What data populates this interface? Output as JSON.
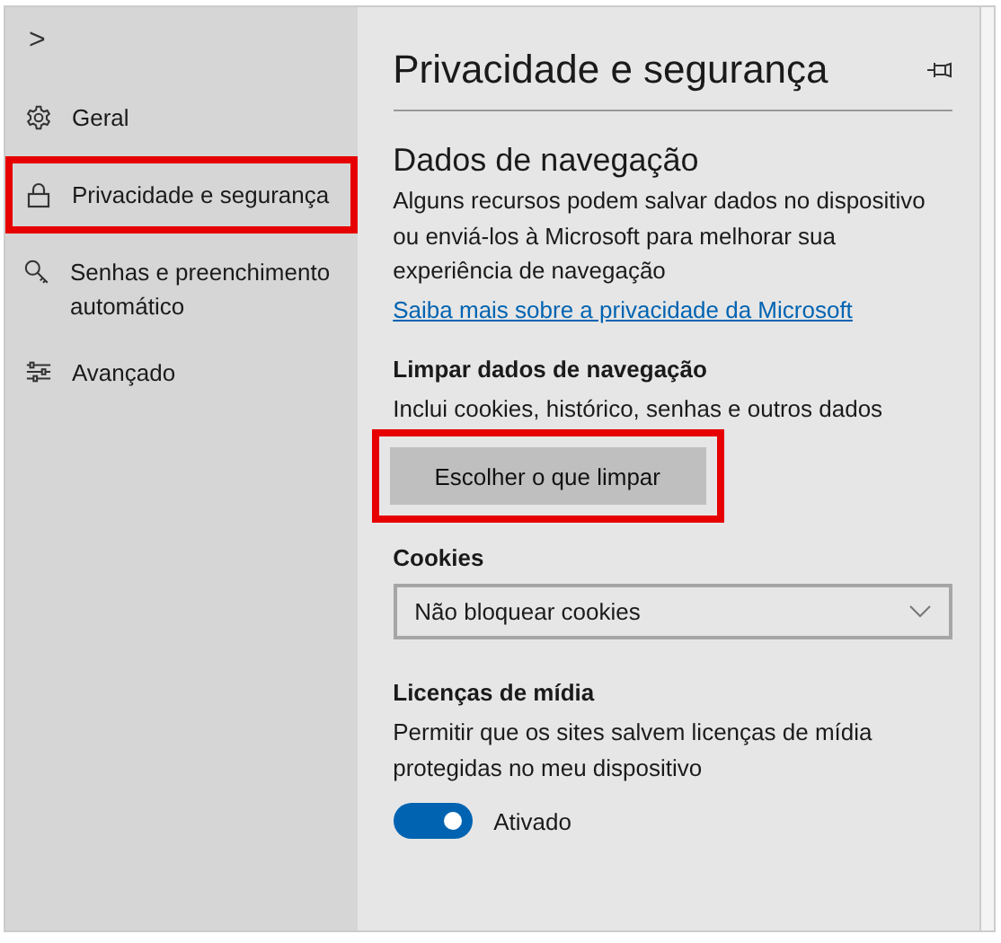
{
  "sidebar": {
    "collapse_glyph": ">",
    "items": [
      {
        "label": "Geral",
        "highlighted": false
      },
      {
        "label": "Privacidade e segurança",
        "highlighted": true
      },
      {
        "label": "Senhas e preenchimento automático",
        "highlighted": false
      },
      {
        "label": "Avançado",
        "highlighted": false
      }
    ]
  },
  "panel": {
    "title": "Privacidade e segurança",
    "browsing_data": {
      "heading": "Dados de navegação",
      "description": "Alguns recursos podem salvar dados no dispositivo ou enviá-los à Microsoft para melhorar sua experiência de navegação",
      "link": "Saiba mais sobre a privacidade da Microsoft"
    },
    "clear": {
      "heading": "Limpar dados de navegação",
      "description": "Inclui cookies, histórico, senhas e outros dados",
      "button": "Escolher o que limpar",
      "highlighted": true
    },
    "cookies": {
      "label": "Cookies",
      "value": "Não bloquear cookies"
    },
    "media": {
      "heading": "Licenças de mídia",
      "description": "Permitir que os sites salvem licenças de mídia protegidas no meu dispositivo",
      "toggle_label": "Ativado",
      "on": true
    }
  }
}
